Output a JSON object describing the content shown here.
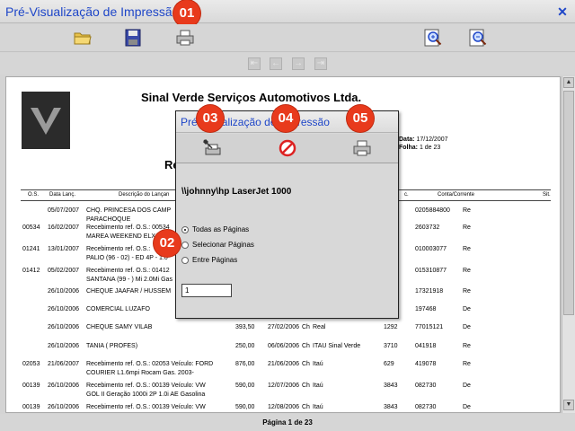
{
  "window": {
    "title": "Pré-Visualização de Impressão",
    "close_glyph": "✕"
  },
  "badges": [
    "01",
    "02",
    "03",
    "04",
    "05"
  ],
  "toolbar": {
    "icons": [
      "open-folder-icon",
      "save-disk-icon",
      "printer-icon",
      "zoom-in-icon",
      "zoom-out-icon"
    ]
  },
  "nav": {
    "first": "⇤",
    "prev": "←",
    "next": "→",
    "last": "⇥"
  },
  "report": {
    "company": "Sinal Verde Serviços Automotivos Ltda.",
    "title_partial": "Re",
    "data_label": "Data:",
    "data_value": "17/12/2007",
    "folha_label": "Folha:",
    "folha_value": "1 de 23",
    "headers": {
      "os": "O.S.",
      "data": "Data Lanç.",
      "desc": "Descrição do Lançan",
      "doc": "c.",
      "conta": "Conta/Corrente",
      "sit": "Sit."
    },
    "rows": [
      {
        "os": "",
        "data": "05/07/2007",
        "desc": "CHQ. PRINCESA DOS CAMP",
        "desc2": "PARACHOQUE",
        "v": "",
        "dt2": "",
        "tp": "",
        "banco": "",
        "doc": "",
        "conta": "0205884800",
        "sit": "Re"
      },
      {
        "os": "00534",
        "data": "16/02/2007",
        "desc": "Recebimento ref. O.S.: 00534",
        "desc2": "MAREA WEEKEND ELX",
        "v": "",
        "dt2": "",
        "tp": "",
        "banco": "",
        "doc": "",
        "conta": "2603732",
        "sit": "Re"
      },
      {
        "os": "01241",
        "data": "13/01/2007",
        "desc": "Recebimento ref. O.S.:",
        "desc2": "PALIO (96 - 02) - ED 4P - 1.0",
        "v": "",
        "dt2": "",
        "tp": "",
        "banco": "",
        "doc": "",
        "conta": "010003077",
        "sit": "Re"
      },
      {
        "os": "01412",
        "data": "05/02/2007",
        "desc": "Recebimento ref. O.S.: 01412",
        "desc2": "SANTANA (99 - ) Mi 2.0Mi Gas",
        "v": "",
        "dt2": "",
        "tp": "",
        "banco": "",
        "doc": "",
        "conta": "015310877",
        "sit": "Re"
      },
      {
        "os": "",
        "data": "26/10/2006",
        "desc": "CHEQUE JAAFAR / HUSSEM",
        "desc2": "",
        "v": "",
        "dt2": "",
        "tp": "",
        "banco": "",
        "doc": "",
        "conta": "17321918",
        "sit": "Re"
      },
      {
        "os": "",
        "data": "26/10/2006",
        "desc": "COMERCIAL LUZAFO",
        "desc2": "",
        "v": "",
        "dt2": "",
        "tp": "",
        "banco": "",
        "doc": "",
        "conta": "197468",
        "sit": "De"
      },
      {
        "os": "",
        "data": "26/10/2006",
        "desc": "CHEQUE SAMY VILAB",
        "desc2": "",
        "v": "393,50",
        "dt2": "27/02/2006",
        "tp": "Ch",
        "banco": "Real",
        "doc": "1292",
        "conta": "77015121",
        "sit": "De"
      },
      {
        "os": "",
        "data": "26/10/2006",
        "desc": "TANIA ( PROFES)",
        "desc2": "",
        "v": "250,00",
        "dt2": "06/06/2006",
        "tp": "Ch",
        "banco": "ITAU Sinal Verde",
        "doc": "3710",
        "conta": "041918",
        "sit": "Re"
      },
      {
        "os": "02053",
        "data": "21/06/2007",
        "desc": "Recebimento ref. O.S.: 02053 Veículo: FORD",
        "desc2": "COURIER L1.6mpi Rocam Gas. 2003-",
        "v": "876,00",
        "dt2": "21/06/2006",
        "tp": "Ch",
        "banco": "Itaú",
        "doc": "629",
        "conta": "419078",
        "sit": "Re"
      },
      {
        "os": "00139",
        "data": "26/10/2006",
        "desc": "Recebimento ref. O.S.: 00139 Veículo: VW",
        "desc2": "GOL II Geração 1000i 2P 1.0i AE Gasolina",
        "v": "590,00",
        "dt2": "12/07/2006",
        "tp": "Ch",
        "banco": "Itaú",
        "doc": "3843",
        "conta": "082730",
        "sit": "De"
      },
      {
        "os": "00139",
        "data": "26/10/2006",
        "desc": "Recebimento ref. O.S.: 00139 Veículo: VW",
        "desc2": "GOL II Geração 1000i 2P 1.0i AE Gasolina",
        "v": "590,00",
        "dt2": "12/08/2006",
        "tp": "Ch",
        "banco": "Itaú",
        "doc": "3843",
        "conta": "082730",
        "sit": "De"
      }
    ]
  },
  "footer": {
    "page": "Página 1 de 23"
  },
  "dialog": {
    "title": "Pré-Visualização de Impressão",
    "printer": "\\\\johnny\\hp LaserJet 1000",
    "options": [
      "Todas as Páginas",
      "Selecionar Páginas",
      "Entre Páginas"
    ],
    "selected_option": "Todas as Páginas",
    "page_value": "1",
    "icons": [
      "printer-settings-icon",
      "cancel-print-icon",
      "print-icon"
    ]
  },
  "colors": {
    "title_blue": "#1e46c8",
    "badge_red": "#e83a1c"
  }
}
